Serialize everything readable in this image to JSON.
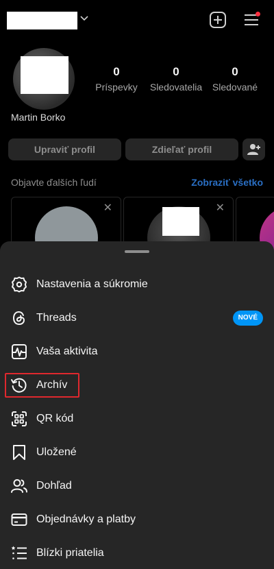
{
  "profile": {
    "display_name": "Martin Borko",
    "stats": [
      {
        "count": "0",
        "label": "Príspevky"
      },
      {
        "count": "0",
        "label": "Sledovatelia"
      },
      {
        "count": "0",
        "label": "Sledované"
      }
    ],
    "edit_label": "Upraviť profil",
    "share_label": "Zdieľať profil"
  },
  "discover": {
    "title": "Objavte ďalších ľudí",
    "see_all": "Zobraziť všetko"
  },
  "menu": {
    "items": [
      {
        "label": "Nastavenia a súkromie",
        "icon": "gear-icon"
      },
      {
        "label": "Threads",
        "icon": "threads-icon",
        "badge": "NOVÉ"
      },
      {
        "label": "Vaša aktivita",
        "icon": "activity-icon"
      },
      {
        "label": "Archív",
        "icon": "archive-icon"
      },
      {
        "label": "QR kód",
        "icon": "qr-code-icon"
      },
      {
        "label": "Uložené",
        "icon": "bookmark-icon"
      },
      {
        "label": "Dohľad",
        "icon": "supervision-icon"
      },
      {
        "label": "Objednávky a platby",
        "icon": "card-icon"
      },
      {
        "label": "Blízki priatelia",
        "icon": "close-friends-icon"
      }
    ]
  },
  "colors": {
    "background": "#000000",
    "sheet": "#262626",
    "accent_link": "#2a6fc4",
    "badge": "#0095f6",
    "notification_dot": "#ff3040",
    "highlight_box": "#e0282e"
  }
}
